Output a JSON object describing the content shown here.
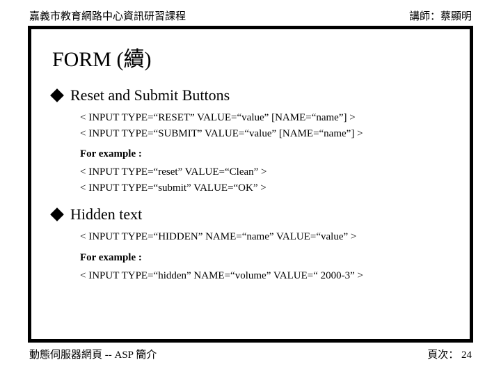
{
  "header": {
    "left": "嘉義市教育網路中心資訊研習課程",
    "right": "講師：蔡顯明"
  },
  "title": "FORM (續)",
  "sections": [
    {
      "heading": "Reset and Submit Buttons",
      "syntax": [
        "< INPUT  TYPE=\"RESET\"  VALUE=\"value\"  [NAME=\"name\"] >",
        "< INPUT  TYPE=\"SUBMIT\"  VALUE=\"value\"  [NAME=\"name\"] >"
      ],
      "example_label": "For example :",
      "example": [
        "< INPUT  TYPE=\"reset\"   VALUE=\"Clean\" >",
        "< INPUT  TYPE=\"submit\"  VALUE=\"OK\" >"
      ]
    },
    {
      "heading": "Hidden text",
      "syntax": [
        "< INPUT  TYPE=\"HIDDEN\"  NAME=\"name\"  VALUE=\"value\" >"
      ],
      "example_label": "For example :",
      "example": [
        "< INPUT  TYPE=\"hidden\"  NAME=\"volume\"  VALUE=\" 2000-3\" >"
      ]
    }
  ],
  "footer": {
    "left": "動態伺服器網頁 -- ASP 簡介",
    "right": "頁次： 24"
  }
}
